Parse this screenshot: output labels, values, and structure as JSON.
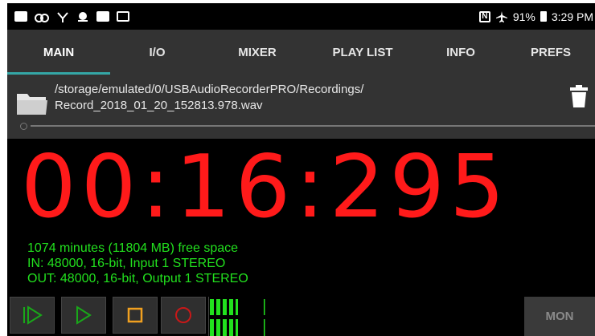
{
  "statusbar": {
    "battery": "91%",
    "time": "3:29 PM",
    "icons": [
      "notification-icon",
      "voicemail-icon",
      "directv-icon",
      "directv-icon",
      "image-icon",
      "mail-icon"
    ]
  },
  "tabs": [
    {
      "label": "MAIN",
      "active": true
    },
    {
      "label": "I/O",
      "active": false
    },
    {
      "label": "MIXER",
      "active": false
    },
    {
      "label": "PLAY LIST",
      "active": false
    },
    {
      "label": "INFO",
      "active": false
    },
    {
      "label": "PREFS",
      "active": false
    }
  ],
  "file": {
    "path_line1": "/storage/emulated/0/USBAudioRecorderPRO/Recordings/",
    "path_line2": "Record_2018_01_20_152813.978.wav"
  },
  "timer": "00:16:295",
  "info": {
    "free_space": "1074 minutes (11804 MB) free space",
    "input": "IN: 48000, 16-bit, Input 1 STEREO",
    "output": "OUT: 48000, 16-bit, Output 1 STEREO"
  },
  "controls": {
    "mon_label": "MON"
  },
  "colors": {
    "accent": "#34a7a6",
    "timer": "#ff1a1a",
    "info": "#22e11e"
  }
}
